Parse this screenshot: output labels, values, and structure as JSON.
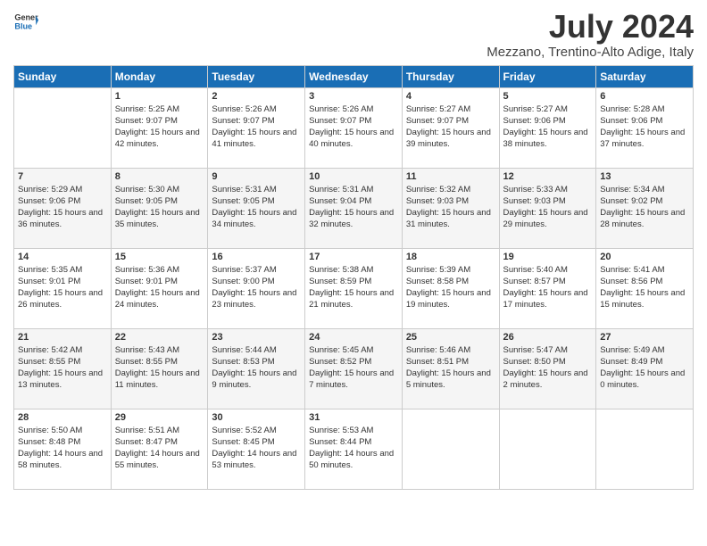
{
  "header": {
    "logo_line1": "General",
    "logo_line2": "Blue",
    "month_year": "July 2024",
    "location": "Mezzano, Trentino-Alto Adige, Italy"
  },
  "days_of_week": [
    "Sunday",
    "Monday",
    "Tuesday",
    "Wednesday",
    "Thursday",
    "Friday",
    "Saturday"
  ],
  "weeks": [
    [
      {
        "day": "",
        "sunrise": "",
        "sunset": "",
        "daylight": ""
      },
      {
        "day": "1",
        "sunrise": "Sunrise: 5:25 AM",
        "sunset": "Sunset: 9:07 PM",
        "daylight": "Daylight: 15 hours and 42 minutes."
      },
      {
        "day": "2",
        "sunrise": "Sunrise: 5:26 AM",
        "sunset": "Sunset: 9:07 PM",
        "daylight": "Daylight: 15 hours and 41 minutes."
      },
      {
        "day": "3",
        "sunrise": "Sunrise: 5:26 AM",
        "sunset": "Sunset: 9:07 PM",
        "daylight": "Daylight: 15 hours and 40 minutes."
      },
      {
        "day": "4",
        "sunrise": "Sunrise: 5:27 AM",
        "sunset": "Sunset: 9:07 PM",
        "daylight": "Daylight: 15 hours and 39 minutes."
      },
      {
        "day": "5",
        "sunrise": "Sunrise: 5:27 AM",
        "sunset": "Sunset: 9:06 PM",
        "daylight": "Daylight: 15 hours and 38 minutes."
      },
      {
        "day": "6",
        "sunrise": "Sunrise: 5:28 AM",
        "sunset": "Sunset: 9:06 PM",
        "daylight": "Daylight: 15 hours and 37 minutes."
      }
    ],
    [
      {
        "day": "7",
        "sunrise": "Sunrise: 5:29 AM",
        "sunset": "Sunset: 9:06 PM",
        "daylight": "Daylight: 15 hours and 36 minutes."
      },
      {
        "day": "8",
        "sunrise": "Sunrise: 5:30 AM",
        "sunset": "Sunset: 9:05 PM",
        "daylight": "Daylight: 15 hours and 35 minutes."
      },
      {
        "day": "9",
        "sunrise": "Sunrise: 5:31 AM",
        "sunset": "Sunset: 9:05 PM",
        "daylight": "Daylight: 15 hours and 34 minutes."
      },
      {
        "day": "10",
        "sunrise": "Sunrise: 5:31 AM",
        "sunset": "Sunset: 9:04 PM",
        "daylight": "Daylight: 15 hours and 32 minutes."
      },
      {
        "day": "11",
        "sunrise": "Sunrise: 5:32 AM",
        "sunset": "Sunset: 9:03 PM",
        "daylight": "Daylight: 15 hours and 31 minutes."
      },
      {
        "day": "12",
        "sunrise": "Sunrise: 5:33 AM",
        "sunset": "Sunset: 9:03 PM",
        "daylight": "Daylight: 15 hours and 29 minutes."
      },
      {
        "day": "13",
        "sunrise": "Sunrise: 5:34 AM",
        "sunset": "Sunset: 9:02 PM",
        "daylight": "Daylight: 15 hours and 28 minutes."
      }
    ],
    [
      {
        "day": "14",
        "sunrise": "Sunrise: 5:35 AM",
        "sunset": "Sunset: 9:01 PM",
        "daylight": "Daylight: 15 hours and 26 minutes."
      },
      {
        "day": "15",
        "sunrise": "Sunrise: 5:36 AM",
        "sunset": "Sunset: 9:01 PM",
        "daylight": "Daylight: 15 hours and 24 minutes."
      },
      {
        "day": "16",
        "sunrise": "Sunrise: 5:37 AM",
        "sunset": "Sunset: 9:00 PM",
        "daylight": "Daylight: 15 hours and 23 minutes."
      },
      {
        "day": "17",
        "sunrise": "Sunrise: 5:38 AM",
        "sunset": "Sunset: 8:59 PM",
        "daylight": "Daylight: 15 hours and 21 minutes."
      },
      {
        "day": "18",
        "sunrise": "Sunrise: 5:39 AM",
        "sunset": "Sunset: 8:58 PM",
        "daylight": "Daylight: 15 hours and 19 minutes."
      },
      {
        "day": "19",
        "sunrise": "Sunrise: 5:40 AM",
        "sunset": "Sunset: 8:57 PM",
        "daylight": "Daylight: 15 hours and 17 minutes."
      },
      {
        "day": "20",
        "sunrise": "Sunrise: 5:41 AM",
        "sunset": "Sunset: 8:56 PM",
        "daylight": "Daylight: 15 hours and 15 minutes."
      }
    ],
    [
      {
        "day": "21",
        "sunrise": "Sunrise: 5:42 AM",
        "sunset": "Sunset: 8:55 PM",
        "daylight": "Daylight: 15 hours and 13 minutes."
      },
      {
        "day": "22",
        "sunrise": "Sunrise: 5:43 AM",
        "sunset": "Sunset: 8:55 PM",
        "daylight": "Daylight: 15 hours and 11 minutes."
      },
      {
        "day": "23",
        "sunrise": "Sunrise: 5:44 AM",
        "sunset": "Sunset: 8:53 PM",
        "daylight": "Daylight: 15 hours and 9 minutes."
      },
      {
        "day": "24",
        "sunrise": "Sunrise: 5:45 AM",
        "sunset": "Sunset: 8:52 PM",
        "daylight": "Daylight: 15 hours and 7 minutes."
      },
      {
        "day": "25",
        "sunrise": "Sunrise: 5:46 AM",
        "sunset": "Sunset: 8:51 PM",
        "daylight": "Daylight: 15 hours and 5 minutes."
      },
      {
        "day": "26",
        "sunrise": "Sunrise: 5:47 AM",
        "sunset": "Sunset: 8:50 PM",
        "daylight": "Daylight: 15 hours and 2 minutes."
      },
      {
        "day": "27",
        "sunrise": "Sunrise: 5:49 AM",
        "sunset": "Sunset: 8:49 PM",
        "daylight": "Daylight: 15 hours and 0 minutes."
      }
    ],
    [
      {
        "day": "28",
        "sunrise": "Sunrise: 5:50 AM",
        "sunset": "Sunset: 8:48 PM",
        "daylight": "Daylight: 14 hours and 58 minutes."
      },
      {
        "day": "29",
        "sunrise": "Sunrise: 5:51 AM",
        "sunset": "Sunset: 8:47 PM",
        "daylight": "Daylight: 14 hours and 55 minutes."
      },
      {
        "day": "30",
        "sunrise": "Sunrise: 5:52 AM",
        "sunset": "Sunset: 8:45 PM",
        "daylight": "Daylight: 14 hours and 53 minutes."
      },
      {
        "day": "31",
        "sunrise": "Sunrise: 5:53 AM",
        "sunset": "Sunset: 8:44 PM",
        "daylight": "Daylight: 14 hours and 50 minutes."
      },
      {
        "day": "",
        "sunrise": "",
        "sunset": "",
        "daylight": ""
      },
      {
        "day": "",
        "sunrise": "",
        "sunset": "",
        "daylight": ""
      },
      {
        "day": "",
        "sunrise": "",
        "sunset": "",
        "daylight": ""
      }
    ]
  ]
}
